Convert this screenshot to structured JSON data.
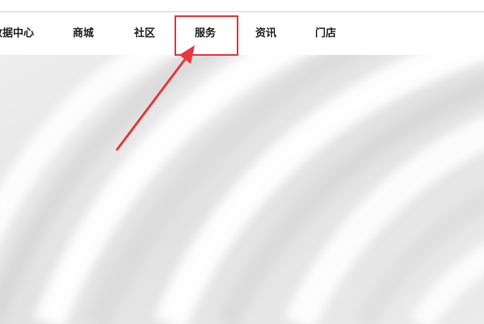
{
  "nav": {
    "items": [
      {
        "key": "data-center",
        "label": "数据中心"
      },
      {
        "key": "mall",
        "label": "商城"
      },
      {
        "key": "community",
        "label": "社区"
      },
      {
        "key": "service",
        "label": "服务"
      },
      {
        "key": "news",
        "label": "资讯"
      },
      {
        "key": "store",
        "label": "门店"
      }
    ],
    "highlighted": "服务"
  },
  "annotation": {
    "color": "#e8383d"
  }
}
